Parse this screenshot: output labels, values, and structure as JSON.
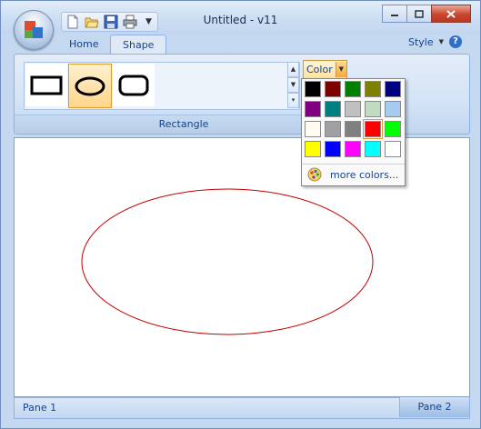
{
  "window": {
    "title": "Untitled - v11"
  },
  "tabs": [
    {
      "label": "Home"
    },
    {
      "label": "Shape"
    }
  ],
  "style_menu": {
    "label": "Style"
  },
  "ribbon": {
    "gallery": [
      {
        "name": "rectangle",
        "selected": false
      },
      {
        "name": "ellipse",
        "selected": true
      },
      {
        "name": "rounded-rectangle",
        "selected": false
      }
    ],
    "group_label": "Rectangle",
    "color_button": "Color"
  },
  "color_menu": {
    "swatches": [
      "#000000",
      "#800000",
      "#008000",
      "#808000",
      "#000080",
      "#800080",
      "#008080",
      "#c0c0c0",
      "#c0dcc0",
      "#a6caf0",
      "#fffbf0",
      "#a0a0a4",
      "#808080",
      "#ff0000",
      "#00ff00",
      "#ffff00",
      "#0000ff",
      "#ff00ff",
      "#00ffff",
      "#ffffff"
    ],
    "selected_swatch": "#ff0000",
    "more_colors": "more colors..."
  },
  "canvas": {
    "shape": "ellipse",
    "stroke_color": "#c00000"
  },
  "status": {
    "pane1": "Pane 1",
    "pane2": "Pane 2"
  }
}
